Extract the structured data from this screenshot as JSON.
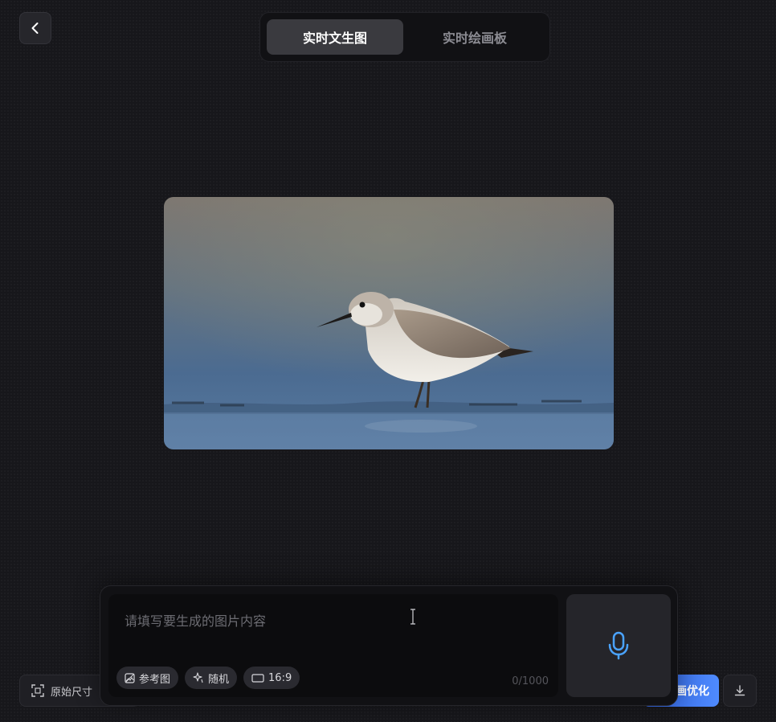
{
  "tabs": [
    {
      "label": "实时文生图",
      "active": true
    },
    {
      "label": "实时绘画板",
      "active": false
    }
  ],
  "canvas": {
    "bg_top": "#7d7670",
    "bg_bottom": "#4b6b91"
  },
  "bottom_bar": {
    "original_size_label": "原始尺寸",
    "optimize_label": "画优化"
  },
  "prompt": {
    "placeholder": "请填写要生成的图片内容",
    "counter": "0/1000",
    "chips": [
      {
        "label": "参考图",
        "icon": "image-reference-icon"
      },
      {
        "label": "随机",
        "icon": "sparkle-icon"
      },
      {
        "label": "16:9",
        "icon": "aspect-ratio-icon"
      }
    ]
  },
  "colors": {
    "accent": "#4f8bff",
    "mic": "#4aa3ff"
  }
}
